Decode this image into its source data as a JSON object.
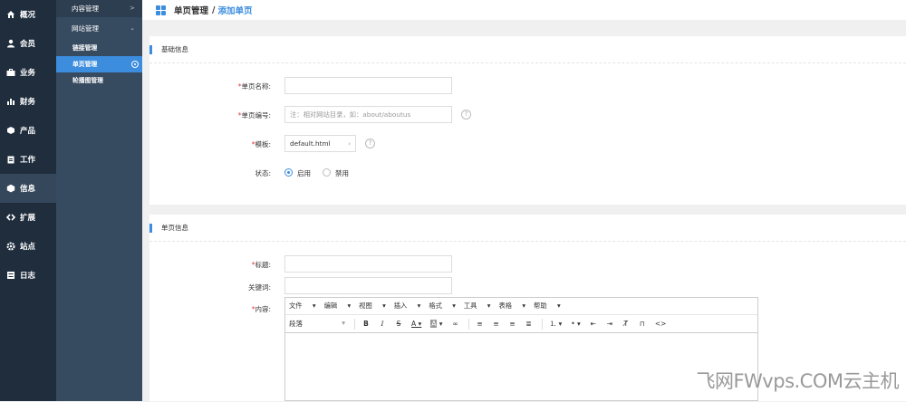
{
  "nav_primary": [
    {
      "label": "概况",
      "icon": "home-icon"
    },
    {
      "label": "会员",
      "icon": "user-icon"
    },
    {
      "label": "业务",
      "icon": "briefcase-icon"
    },
    {
      "label": "财务",
      "icon": "bar-chart-icon"
    },
    {
      "label": "产品",
      "icon": "cube-icon"
    },
    {
      "label": "工作",
      "icon": "clipboard-icon"
    },
    {
      "label": "信息",
      "icon": "box-icon"
    },
    {
      "label": "扩展",
      "icon": "code-icon"
    },
    {
      "label": "站点",
      "icon": "gear-icon"
    },
    {
      "label": "日志",
      "icon": "list-icon"
    }
  ],
  "nav_secondary": {
    "group1": "内容管理",
    "group1_chevron": ">",
    "group2": "网站管理",
    "group2_chevron": "⌄",
    "items": [
      "链接管理",
      "单页管理",
      "轮播图管理"
    ]
  },
  "breadcrumb": {
    "parent": "单页管理",
    "sep": "/",
    "current": "添加单页"
  },
  "basic": {
    "title": "基础信息",
    "name_label": "单页名称:",
    "code_label": "单页编号:",
    "code_placeholder": "注：相对网站目录，如：about/aboutus",
    "template_label": "模板:",
    "template_value": "default.html",
    "status_label": "状态:",
    "status_on": "启用",
    "status_off": "禁用",
    "help": "?",
    "required": "*"
  },
  "page_info": {
    "title": "单页信息",
    "title_label": "标题:",
    "keywords_label": "关键词:",
    "content_label": "内容:"
  },
  "editor": {
    "menu": [
      "文件",
      "编辑",
      "视图",
      "插入",
      "格式",
      "工具",
      "表格",
      "帮助"
    ],
    "format": "段落"
  },
  "watermark": "飞网FWvps.COM云主机",
  "colors": {
    "accent": "#3c8dde",
    "sidebar": "#1f2d3d",
    "required": "#e4393c"
  }
}
